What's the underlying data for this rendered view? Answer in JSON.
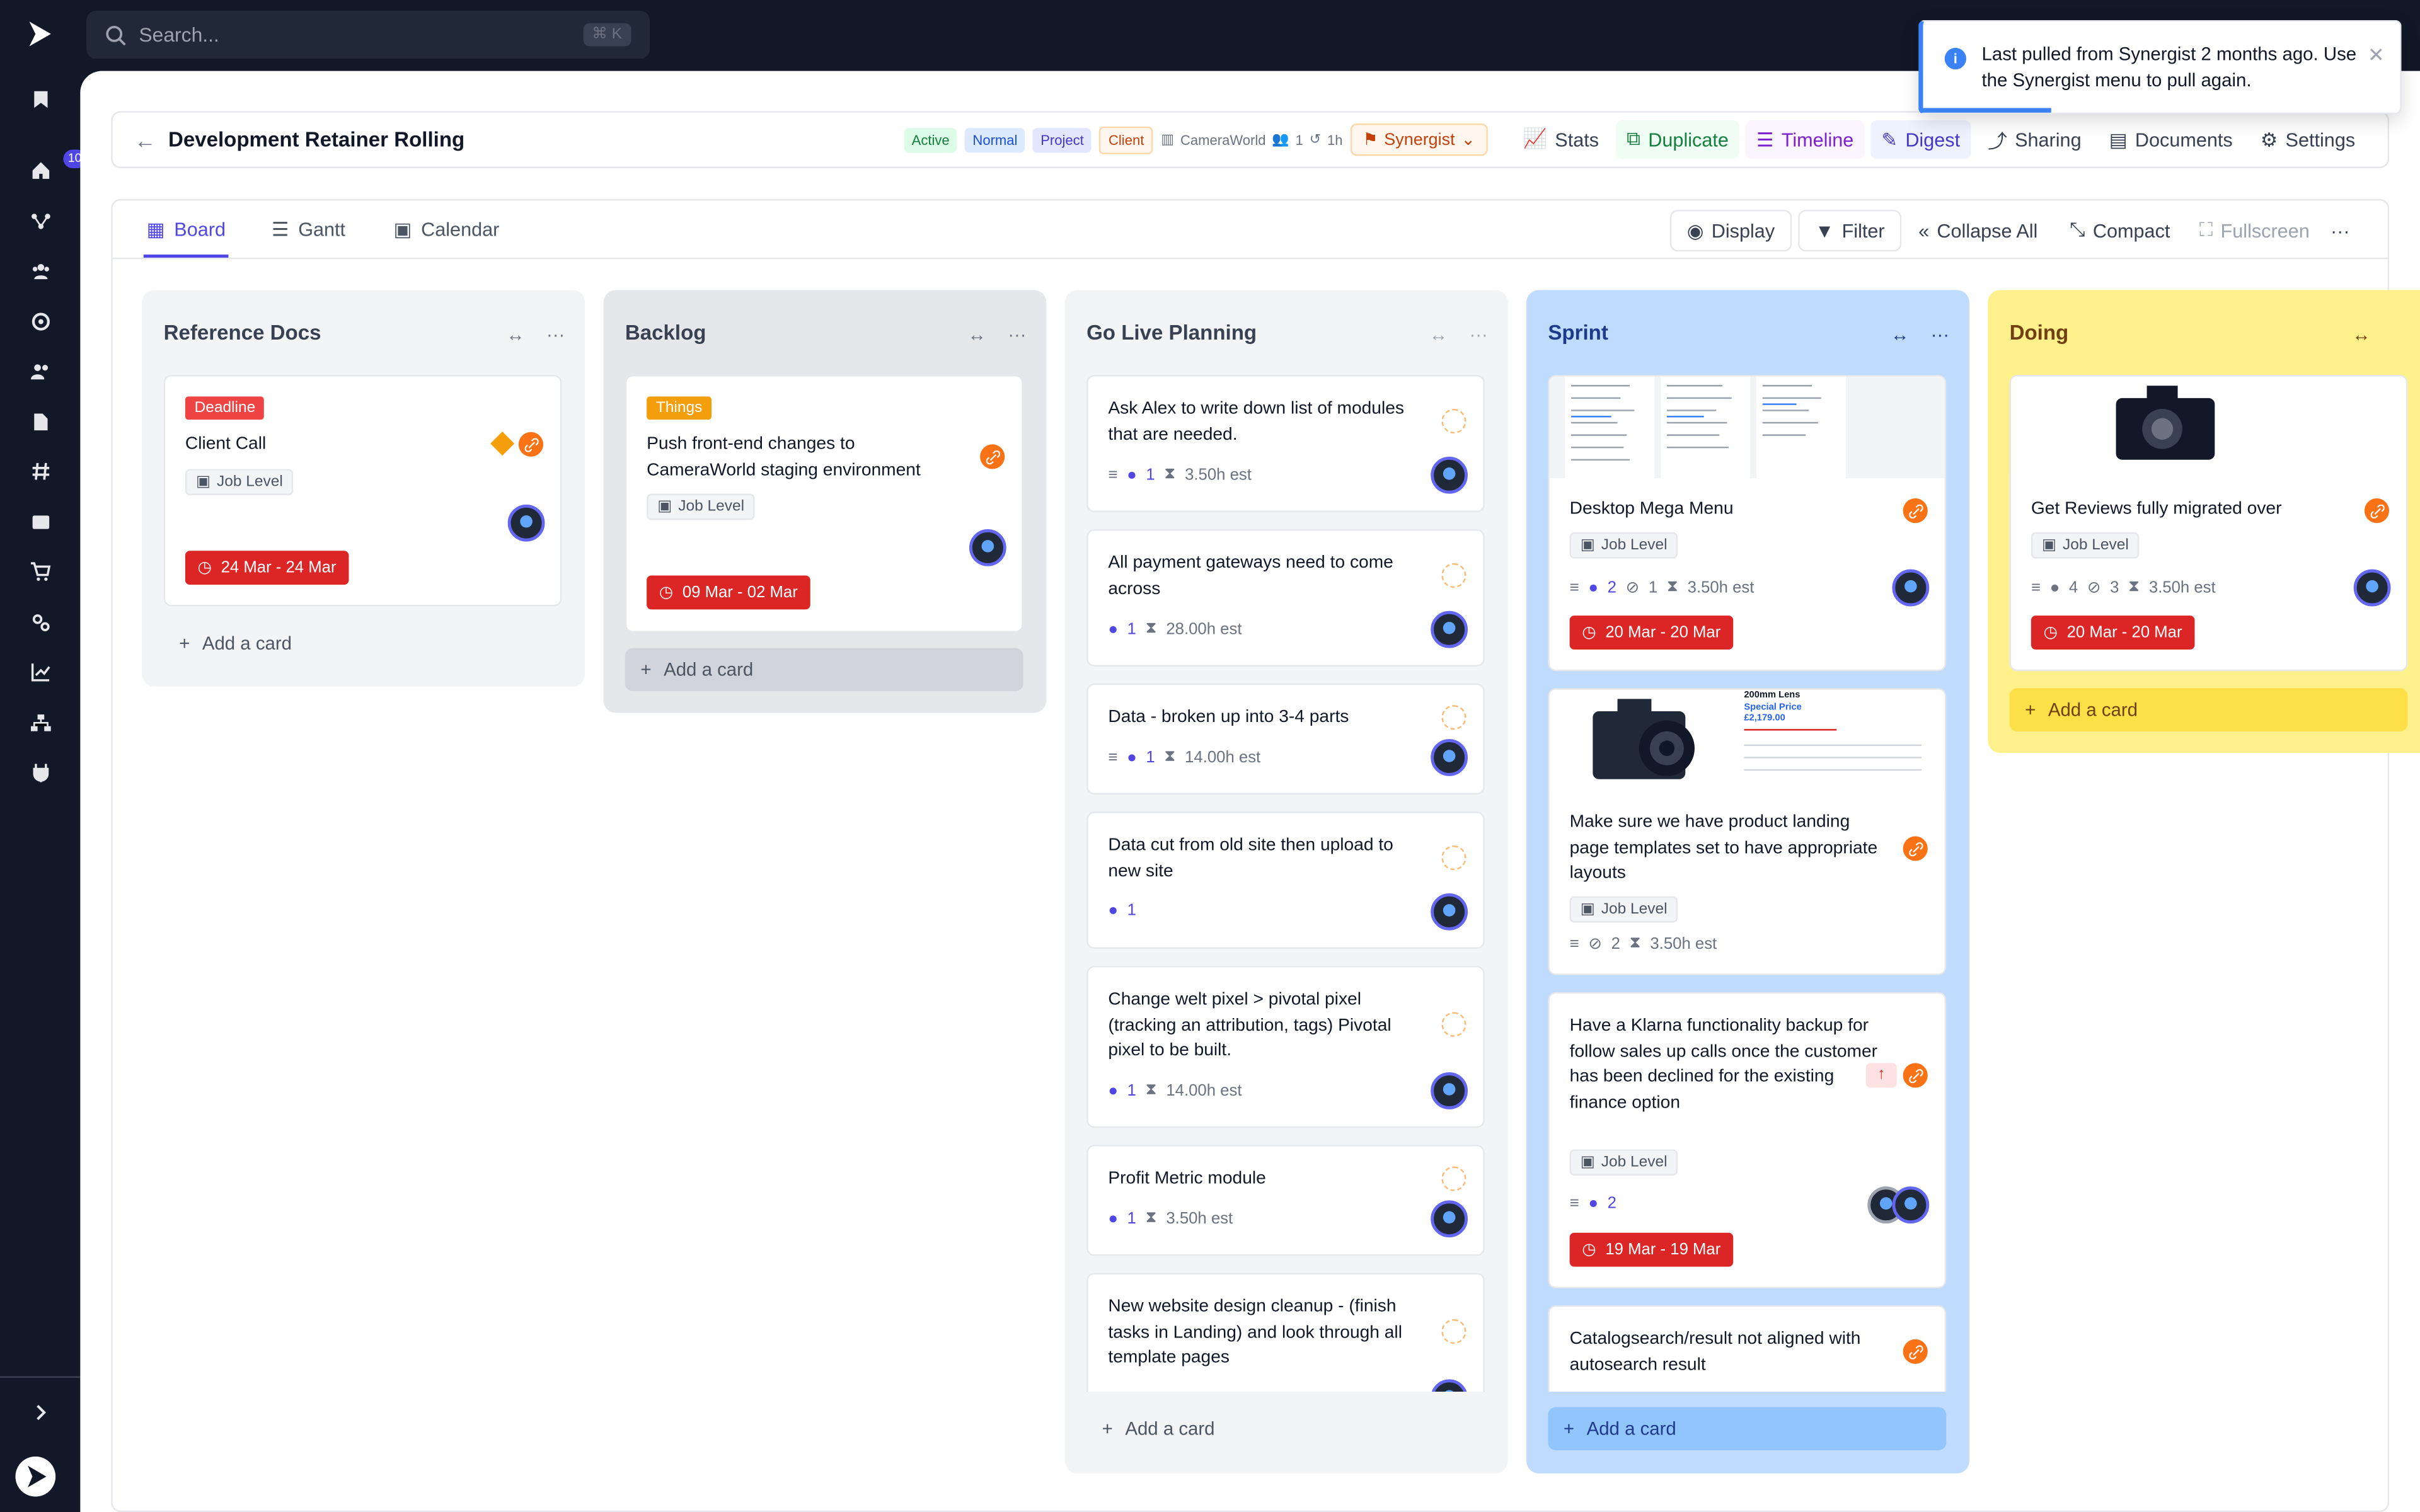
{
  "search": {
    "placeholder": "Search...",
    "shortcut": "⌘ K"
  },
  "sidebar": {
    "badge": "10",
    "icons": [
      "bookmark-icon",
      "home-icon",
      "workflow-icon",
      "team-icon",
      "support-icon",
      "users-icon",
      "document-icon",
      "hash-icon",
      "archive-icon",
      "cart-icon",
      "settings-icon",
      "chart-icon",
      "org-icon",
      "plugin-icon"
    ]
  },
  "header": {
    "title": "Development Retainer Rolling",
    "tags": [
      "Active",
      "Normal",
      "Project",
      "Client"
    ],
    "company": "CameraWorld",
    "members": "1",
    "time": "1h",
    "synergist": "Synergist",
    "buttons": [
      "Stats",
      "Duplicate",
      "Timeline",
      "Digest",
      "Sharing",
      "Documents",
      "Settings"
    ]
  },
  "tabs": [
    "Board",
    "Gantt",
    "Calendar"
  ],
  "toolbar": {
    "display": "Display",
    "filter": "Filter",
    "collapse": "Collapse All",
    "compact": "Compact",
    "fullscreen": "Fullscreen"
  },
  "toast": {
    "message": "Last pulled from Synergist 2 months ago. Use the Synergist menu to pull again."
  },
  "add_card": "Add a card",
  "job_level": "Job Level",
  "columns": [
    {
      "title": "Reference Docs",
      "cards": [
        {
          "label": "Deadline",
          "title": "Client Call",
          "date": "24 Mar - 24 Mar"
        }
      ]
    },
    {
      "title": "Backlog",
      "cards": [
        {
          "label": "Things",
          "title": "Push front-end changes to CameraWorld staging environment",
          "date": "09 Mar - 02 Mar"
        }
      ]
    },
    {
      "title": "Go Live Planning",
      "cards": [
        {
          "title": "Ask Alex to write down list of modules that are needed.",
          "comments": "1",
          "est": "3.50h est"
        },
        {
          "title": "All payment gateways need to come across",
          "comments": "1",
          "est": "28.00h est"
        },
        {
          "title": "Data - broken up into 3-4 parts",
          "comments": "1",
          "est": "14.00h est"
        },
        {
          "title": "Data cut from old site then upload to new site",
          "comments": "1"
        },
        {
          "title": "Change welt pixel > pivotal pixel (tracking an attribution, tags) Pivotal pixel to be built.",
          "comments": "1",
          "est": "14.00h est"
        },
        {
          "title": "Profit Metric module",
          "comments": "1",
          "est": "3.50h est"
        },
        {
          "title": "New website design cleanup - (finish tasks in Landing) and look through all template pages"
        }
      ]
    },
    {
      "title": "Sprint",
      "cards": [
        {
          "title": "Desktop Mega Menu",
          "comments": "2",
          "attachments": "1",
          "est": "3.50h est",
          "date": "20 Mar - 20 Mar"
        },
        {
          "title": "Make sure we have product landing page templates set to have appropriate layouts",
          "attachments": "2",
          "est": "3.50h est",
          "thumb_text": "200mm Lens",
          "thumb_sub": "Special Price",
          "thumb_price": "£2,179.00"
        },
        {
          "title": "Have a Klarna functionality backup for follow sales up calls once the customer has been declined for the existing finance option",
          "comments": "2",
          "date": "19 Mar - 19 Mar"
        },
        {
          "title": "Catalogsearch/result not aligned with autosearch result"
        }
      ]
    },
    {
      "title": "Doing",
      "cards": [
        {
          "title": "Get Reviews fully migrated over",
          "comments": "4",
          "attachments": "3",
          "est": "3.50h est",
          "date": "20 Mar - 20 Mar"
        }
      ]
    }
  ],
  "colors": {
    "primary": "#4f46e5",
    "danger": "#dc2626",
    "orange": "#f97316",
    "sprint_bg": "#bfdbfe",
    "doing_bg": "#fef08a"
  }
}
